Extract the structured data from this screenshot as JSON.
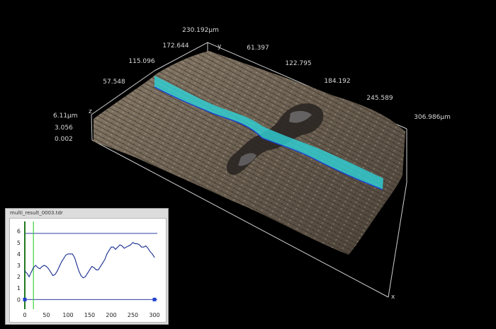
{
  "view3d": {
    "x_axis_ticks": [
      "61.397",
      "122.795",
      "184.192",
      "245.589",
      "306.986µm"
    ],
    "y_axis_ticks": [
      "57.548",
      "115.096",
      "172.644",
      "230.192µm"
    ],
    "y_axis_letter": "y",
    "z_axis_letter": "z",
    "x_axis_letter": "x",
    "z_axis_ticks": [
      "6.11µm",
      "3.056",
      "0.002"
    ],
    "colors": {
      "surface": "#6e6253",
      "surface_dark": "#3e362d",
      "profile_band": "#2fd0d4",
      "profile_edge": "#1c3fd0",
      "axis": "#cfcfcf"
    }
  },
  "profile_window": {
    "title": "multi_result_0003.tdr",
    "colors": {
      "line": "#1a2f8f",
      "cursor": "#3cd23c",
      "baseline": "#2f3f9f"
    }
  },
  "chart_data": {
    "type": "line",
    "title": "",
    "xlabel": "",
    "ylabel": "",
    "xlim": [
      0,
      300
    ],
    "ylim": [
      -0.6,
      6.6
    ],
    "x_ticks": [
      "0",
      "50",
      "100",
      "150",
      "200",
      "250",
      "300"
    ],
    "y_ticks": [
      "0",
      "1",
      "2",
      "3",
      "4",
      "5",
      "6"
    ],
    "reference_lines_y": [
      0,
      5.8
    ],
    "cursor_lines_x": [
      0,
      20
    ],
    "grid": false,
    "series": [
      {
        "x": [
          0,
          5,
          10,
          15,
          20,
          25,
          30,
          35,
          40,
          45,
          50,
          55,
          60,
          65,
          70,
          75,
          80,
          85,
          90,
          95,
          100,
          105,
          110,
          115,
          120,
          125,
          130,
          135,
          140,
          145,
          150,
          155,
          160,
          165,
          170,
          175,
          180,
          185,
          190,
          195,
          200,
          205,
          210,
          215,
          220,
          225,
          230,
          235,
          240,
          245,
          250,
          255,
          260,
          265,
          270,
          275,
          280,
          285,
          290,
          295,
          300
        ],
        "y": [
          2.5,
          2.3,
          2.0,
          2.4,
          2.8,
          3.0,
          2.8,
          2.7,
          2.9,
          3.0,
          2.9,
          2.7,
          2.4,
          2.1,
          2.2,
          2.5,
          2.9,
          3.3,
          3.6,
          3.9,
          4.0,
          4.0,
          4.0,
          3.7,
          3.1,
          2.5,
          2.1,
          1.9,
          2.0,
          2.3,
          2.6,
          2.9,
          2.8,
          2.6,
          2.6,
          2.9,
          3.2,
          3.5,
          4.0,
          4.3,
          4.6,
          4.6,
          4.4,
          4.6,
          4.8,
          4.7,
          4.5,
          4.6,
          4.7,
          4.8,
          5.0,
          4.9,
          4.9,
          4.8,
          4.6,
          4.6,
          4.7,
          4.5,
          4.2,
          4.0,
          3.7
        ]
      }
    ]
  }
}
